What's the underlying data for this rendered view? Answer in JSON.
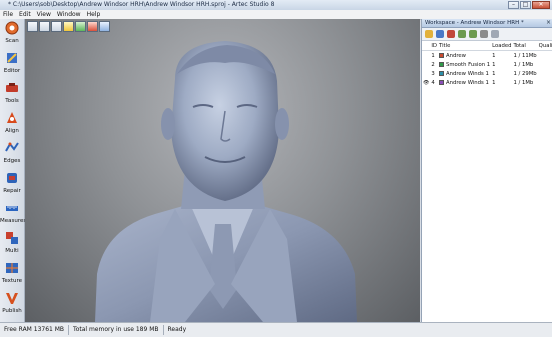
{
  "window": {
    "title": "* C:\\Users\\sob\\Desktop\\Andrew Windsor HRH\\Andrew Windsor HRH.sproj - Artec Studio 8"
  },
  "menu": [
    "File",
    "Edit",
    "View",
    "Window",
    "Help"
  ],
  "left_toolbar": [
    {
      "label": "Scan",
      "icon": "scan-icon",
      "color": "#e06a2c"
    },
    {
      "label": "Editor",
      "icon": "editor-icon",
      "color": "#3b6fc6"
    },
    {
      "label": "Tools",
      "icon": "tools-icon",
      "color": "#c23b2a"
    },
    {
      "label": "Align",
      "icon": "align-icon",
      "color": "#d84a1c"
    },
    {
      "label": "Edges",
      "icon": "edges-icon",
      "color": "#2e63b8"
    },
    {
      "label": "Repair",
      "icon": "repair-icon",
      "color": "#c43f35"
    },
    {
      "label": "Measures",
      "icon": "measures-icon",
      "color": "#2a64c0"
    },
    {
      "label": "Multi",
      "icon": "multi-icon",
      "color": "#c8402e"
    },
    {
      "label": "Texture",
      "icon": "texture-icon",
      "color": "#2f66bd"
    },
    {
      "label": "Publish",
      "icon": "publish-icon",
      "color": "#d6501e"
    }
  ],
  "workspace": {
    "title": "Workspace - Andrew Windsor HRH *",
    "columns": {
      "id": "ID",
      "title": "Title",
      "loaded": "Loaded",
      "total": "Total",
      "quality": "Quality"
    },
    "rows": [
      {
        "id": "1",
        "title": "Andrew",
        "loaded": "1",
        "total": "1 / 11Mb",
        "swatch": "#c94a2f",
        "visible": false
      },
      {
        "id": "2",
        "title": "Smooth Fusion 1",
        "loaded": "1",
        "total": "1 / 1Mb",
        "swatch": "#2f9a4a",
        "visible": false
      },
      {
        "id": "3",
        "title": "Andrew Winds 1",
        "loaded": "1",
        "total": "1 / 29Mb",
        "swatch": "#2b8fa8",
        "visible": false
      },
      {
        "id": "4",
        "title": "Andrew Winds 1",
        "loaded": "1",
        "total": "1 / 1Mb",
        "swatch": "#8a4fb8",
        "visible": true
      }
    ]
  },
  "status": {
    "free_ram": "Free RAM 13761 MB",
    "memory": "Total memory in use 189 MB",
    "state": "Ready"
  }
}
